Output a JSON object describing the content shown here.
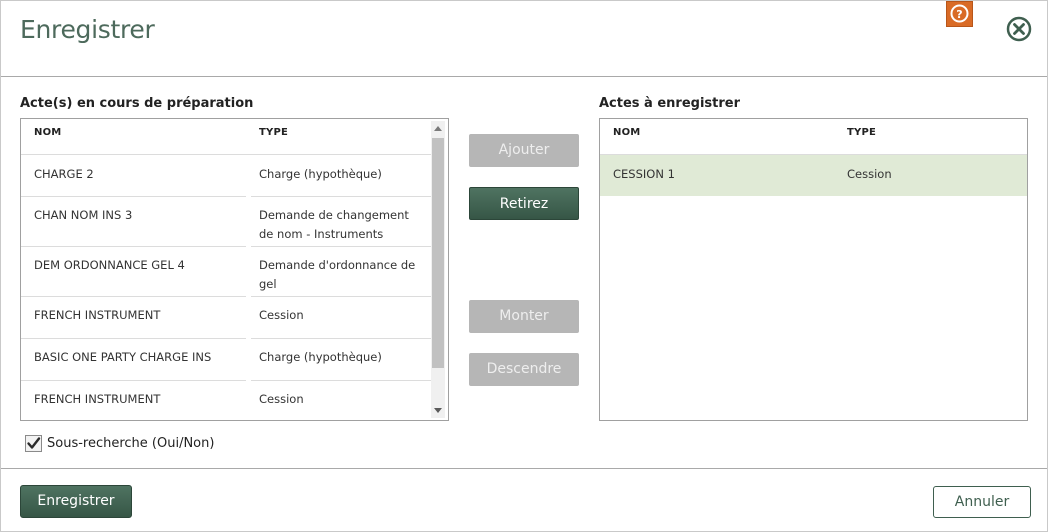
{
  "dialog": {
    "title": "Enregistrer",
    "help_icon": "help-icon",
    "close_icon": "close-icon"
  },
  "left": {
    "label": "Acte(s) en cours de préparation",
    "columns": [
      "NOM",
      "TYPE"
    ],
    "rows": [
      {
        "nom": "CHARGE 2",
        "type": "Charge (hypothèque)"
      },
      {
        "nom": "CHAN NOM INS 3",
        "type": "Demande de changement de nom - Instruments"
      },
      {
        "nom": "DEM ORDONNANCE GEL 4",
        "type": "Demande d'ordonnance de gel"
      },
      {
        "nom": "FRENCH INSTRUMENT",
        "type": "Cession"
      },
      {
        "nom": "BASIC ONE PARTY CHARGE INS",
        "type": "Charge (hypothèque)"
      },
      {
        "nom": "FRENCH INSTRUMENT",
        "type": "Cession"
      }
    ]
  },
  "right": {
    "label": "Actes à enregistrer",
    "columns": [
      "NOM",
      "TYPE"
    ],
    "rows": [
      {
        "nom": "CESSION 1",
        "type": "Cession",
        "selected": true
      }
    ]
  },
  "actions": {
    "add": "Ajouter",
    "remove": "Retirez",
    "up": "Monter",
    "down": "Descendre"
  },
  "subsearch": {
    "label": "Sous-recherche (Oui/Non)",
    "checked": true
  },
  "footer": {
    "save": "Enregistrer",
    "cancel": "Annuler"
  },
  "colors": {
    "accent": "#365646",
    "title": "#4d6a5c",
    "help_bg": "#d96b26",
    "selected_row": "#e0ead6",
    "disabled_button": "#b6b6b6"
  }
}
